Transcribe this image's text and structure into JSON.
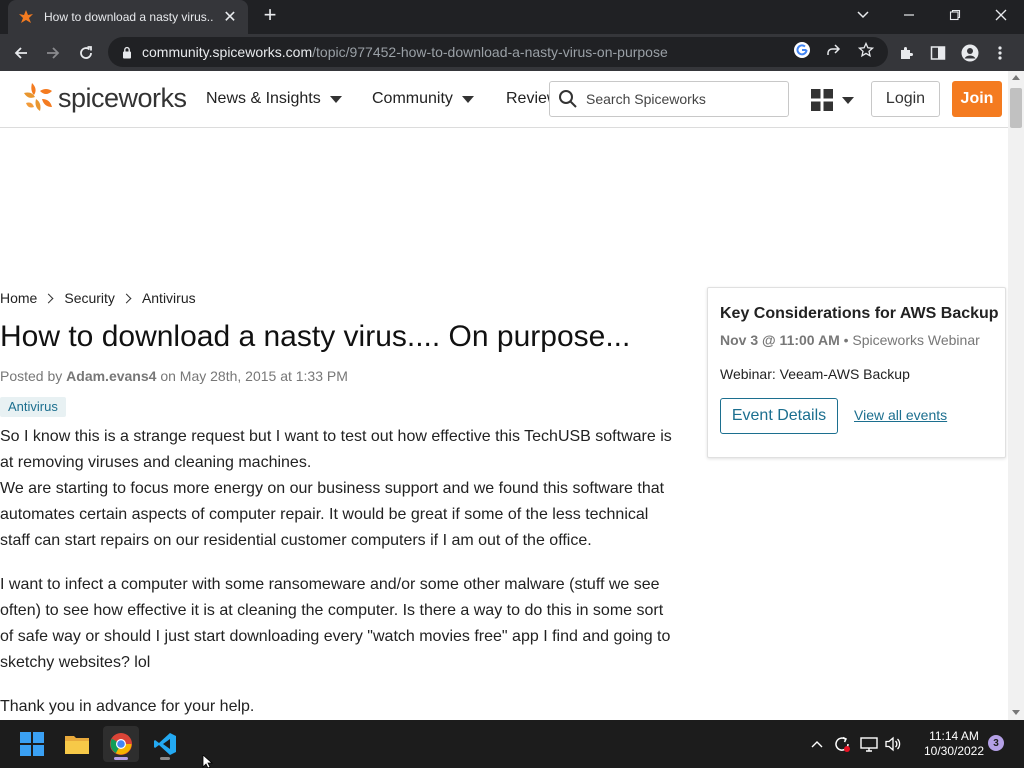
{
  "browser": {
    "tab_title": "How to download a nasty virus...",
    "url_domain": "community.spiceworks.com",
    "url_path": "/topic/977452-how-to-download-a-nasty-virus-on-purpose"
  },
  "site": {
    "logo_text": "spiceworks",
    "nav": [
      "News & Insights",
      "Community",
      "Reviews"
    ],
    "search_placeholder": "Search Spiceworks",
    "login_label": "Login",
    "join_label": "Join",
    "accent_color": "#f47b20",
    "link_color": "#1c6f8f"
  },
  "breadcrumb": [
    "Home",
    "Security",
    "Antivirus"
  ],
  "post": {
    "title": "How to download a nasty virus.... On purpose...",
    "posted_by_prefix": "Posted by",
    "author": "Adam.evans4",
    "date_text": "on May 28th, 2015 at 1:33 PM",
    "tag": "Antivirus",
    "paragraphs": [
      "So I know this is a strange request but I want to test out how effective this TechUSB software is at removing viruses and cleaning machines.",
      "We are starting to focus more energy on our business support and we found this software that automates certain aspects of computer repair. It would be great if some of the less technical staff can start repairs on our residential customer computers if I am out of the office.",
      " I want to infect a computer with some ransomeware and/or some other malware (stuff we see often) to see how effective it is at cleaning the computer. Is there a way to do this in some sort of safe way or should I just start downloading every \"watch movies free\" app I find and going to sketchy websites? lol",
      "Thank you in advance for your help."
    ]
  },
  "event": {
    "title": "Key Considerations for AWS Backup",
    "datetime": "Nov 3 @ 11:00 AM",
    "type": "• Spiceworks Webinar",
    "description": "Webinar: Veeam-AWS Backup",
    "details_button": "Event Details",
    "all_events_link": "View all events"
  },
  "taskbar": {
    "time": "11:14 AM",
    "date": "10/30/2022",
    "notification_count": "3"
  }
}
